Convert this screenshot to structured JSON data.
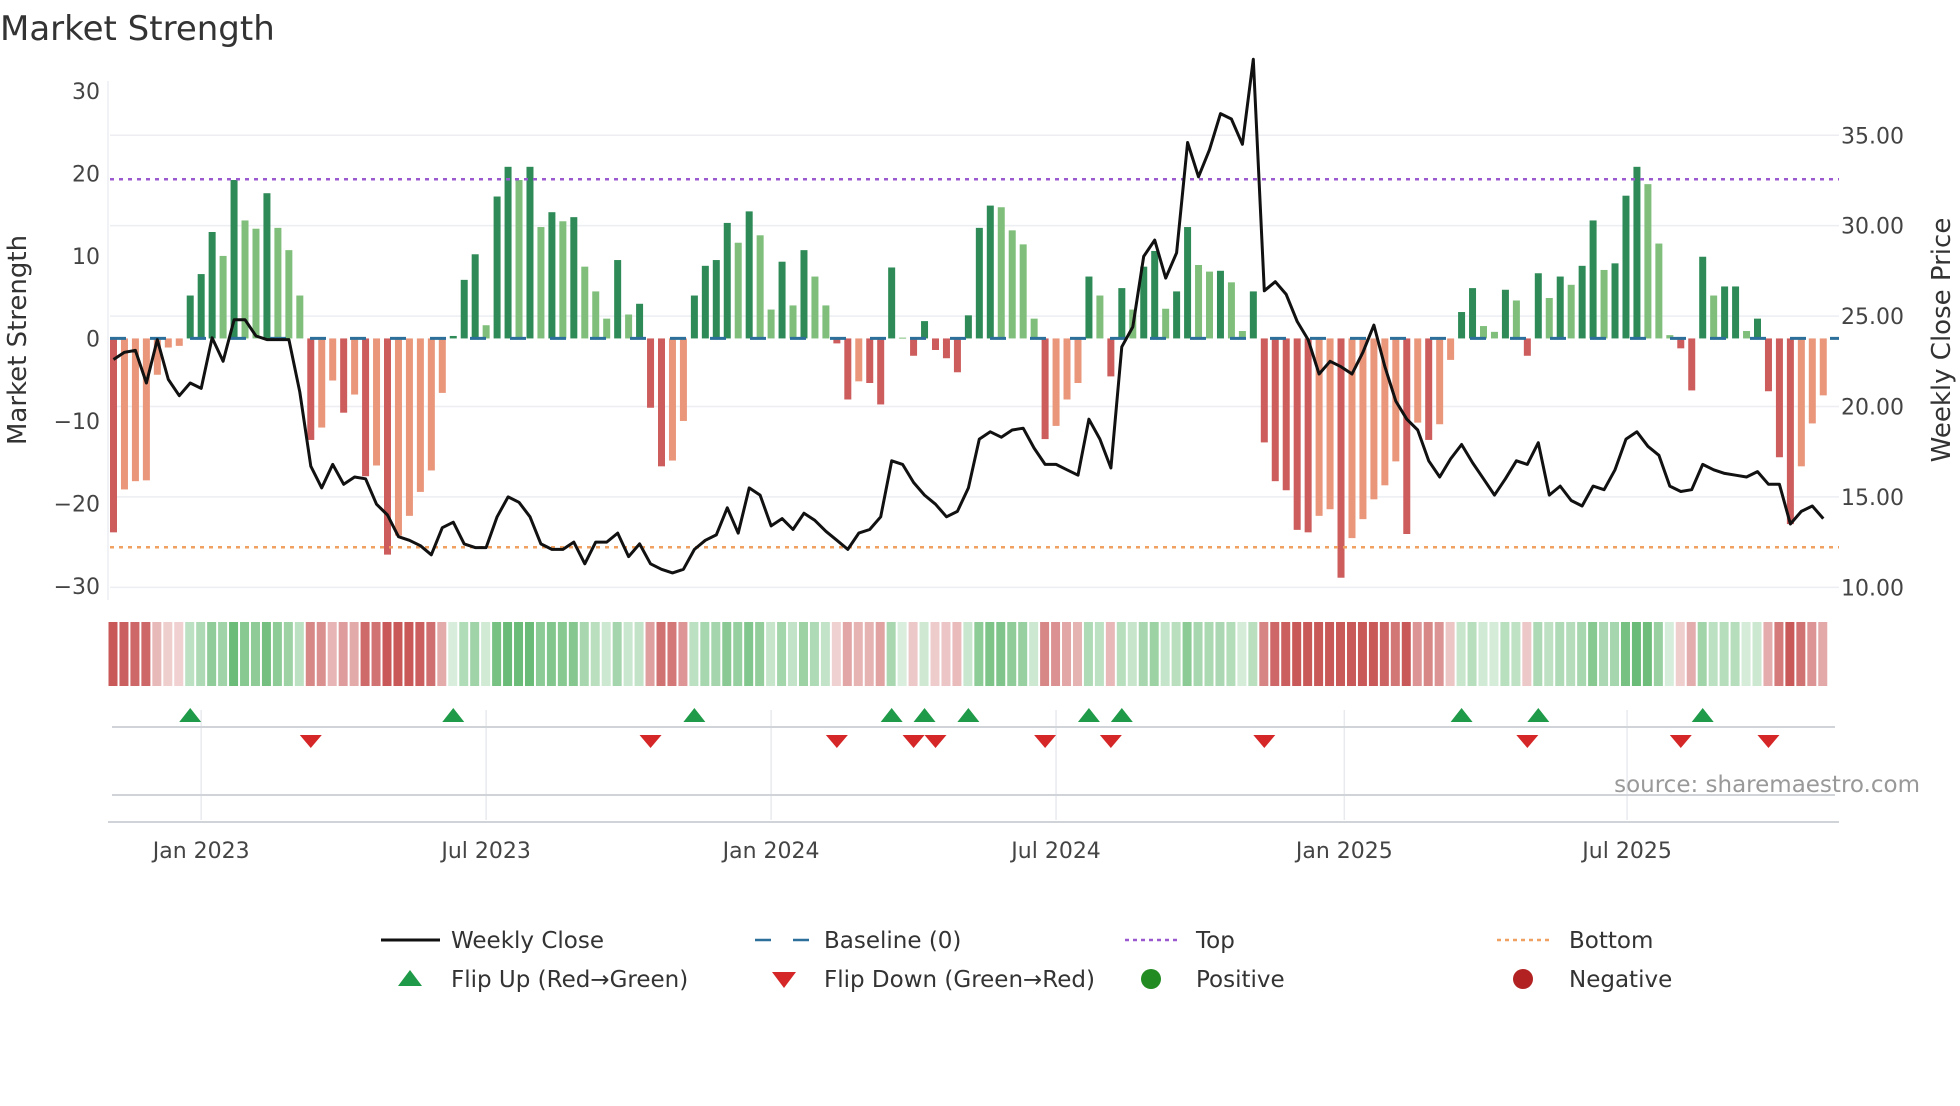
{
  "chart_data": {
    "type": "bar",
    "title": "Market Strength",
    "ylabel": "Market Strength",
    "y2label": "Weekly Close Price",
    "ylim": [
      -31.7,
      31.2
    ],
    "y2lim": [
      9.3,
      38.0
    ],
    "yticks": [
      30,
      20,
      10,
      0,
      -10,
      -20,
      -30
    ],
    "ytick_labels": [
      "30",
      "20",
      "10",
      "0",
      "−10",
      "−20",
      "−30"
    ],
    "y2ticks": [
      35,
      30,
      25,
      20,
      15,
      10
    ],
    "y2tick_labels": [
      "35.00",
      "30.00",
      "25.00",
      "20.00",
      "15.00",
      "10.00"
    ],
    "x_start": "2022-11-06",
    "x_step_days": 7,
    "xticks": [
      {
        "week": 8,
        "label": "Jan 2023"
      },
      {
        "week": 34,
        "label": "Jul 2023"
      },
      {
        "week": 60,
        "label": "Jan 2024"
      },
      {
        "week": 86,
        "label": "Jul 2024"
      },
      {
        "week": 112.3,
        "label": "Jan 2025"
      },
      {
        "week": 138.1,
        "label": "Jul 2025"
      }
    ],
    "top_level": 19.3,
    "bottom_level": -25.3,
    "baseline": 0,
    "strength": [
      -23.5,
      -18.3,
      -17.3,
      -17.2,
      -4.4,
      -1.1,
      -0.9,
      5.2,
      7.8,
      12.9,
      10.0,
      19.2,
      14.3,
      13.3,
      17.6,
      13.4,
      10.7,
      5.2,
      -12.3,
      -10.8,
      -5.1,
      -9.0,
      -6.8,
      -16.7,
      -15.4,
      -26.2,
      -23.9,
      -21.5,
      -18.6,
      -16.0,
      -6.6,
      0.3,
      7.1,
      10.2,
      1.6,
      17.2,
      20.8,
      19.2,
      20.8,
      13.5,
      15.3,
      14.2,
      14.7,
      8.7,
      5.7,
      2.4,
      9.5,
      2.9,
      4.2,
      -8.4,
      -15.5,
      -14.8,
      -10.0,
      5.2,
      8.8,
      9.5,
      14.0,
      11.6,
      15.4,
      12.5,
      3.5,
      9.3,
      4.0,
      10.7,
      7.5,
      4.0,
      -0.6,
      -7.4,
      -5.2,
      -5.4,
      -8.0,
      8.6,
      0.1,
      -2.1,
      2.1,
      -1.4,
      -2.4,
      -4.1,
      2.8,
      13.4,
      16.1,
      15.9,
      13.1,
      11.4,
      2.4,
      -12.2,
      -10.6,
      -7.4,
      -5.4,
      7.5,
      5.2,
      -4.6,
      6.1,
      3.5,
      8.7,
      10.6,
      3.6,
      5.7,
      13.5,
      8.9,
      8.1,
      8.2,
      6.8,
      0.9,
      5.7,
      -12.6,
      -17.3,
      -18.4,
      -23.2,
      -23.5,
      -21.5,
      -20.7,
      -29.0,
      -24.2,
      -21.9,
      -19.5,
      -17.8,
      -14.9,
      -23.7,
      -10.2,
      -12.3,
      -10.4,
      -2.6,
      3.2,
      6.1,
      1.5,
      0.8,
      5.9,
      4.6,
      -2.1,
      7.9,
      4.9,
      7.5,
      6.5,
      8.8,
      14.3,
      8.3,
      9.1,
      17.3,
      20.8,
      18.7,
      11.5,
      0.4,
      -1.2,
      -6.3,
      9.9,
      5.2,
      6.3,
      6.3,
      0.9,
      2.4,
      -6.4,
      -14.4,
      -22.5,
      -15.5,
      -10.3,
      -6.9
    ],
    "weekly_close": [
      22.6,
      23.0,
      23.1,
      21.3,
      23.7,
      21.5,
      20.6,
      21.3,
      21.0,
      23.8,
      22.5,
      24.8,
      24.8,
      23.9,
      23.7,
      23.7,
      23.7,
      20.8,
      16.7,
      15.5,
      16.8,
      15.7,
      16.1,
      16.0,
      14.6,
      14.0,
      12.8,
      12.6,
      12.3,
      11.8,
      13.3,
      13.6,
      12.4,
      12.2,
      12.2,
      13.9,
      15.0,
      14.7,
      13.9,
      12.4,
      12.1,
      12.1,
      12.5,
      11.3,
      12.5,
      12.5,
      13.0,
      11.7,
      12.4,
      11.3,
      11.0,
      10.8,
      11.0,
      12.1,
      12.6,
      12.9,
      14.4,
      13.0,
      15.5,
      15.1,
      13.4,
      13.8,
      13.2,
      14.1,
      13.7,
      13.1,
      12.6,
      12.1,
      13.0,
      13.2,
      13.9,
      17.0,
      16.8,
      15.8,
      15.1,
      14.6,
      13.9,
      14.2,
      15.5,
      18.2,
      18.6,
      18.3,
      18.7,
      18.8,
      17.7,
      16.8,
      16.8,
      16.5,
      16.2,
      19.3,
      18.2,
      16.6,
      23.3,
      24.4,
      28.3,
      29.2,
      27.1,
      28.5,
      34.6,
      32.7,
      34.2,
      36.2,
      35.9,
      34.5,
      39.2,
      26.4,
      26.9,
      26.2,
      24.7,
      23.7,
      21.8,
      22.5,
      22.2,
      21.8,
      23.0,
      24.5,
      22.2,
      20.3,
      19.3,
      18.7,
      17.0,
      16.1,
      17.1,
      17.9,
      16.9,
      16.0,
      15.1,
      16.0,
      17.0,
      16.8,
      18.0,
      15.1,
      15.6,
      14.8,
      14.5,
      15.6,
      15.4,
      16.5,
      18.2,
      18.6,
      17.8,
      17.3,
      15.6,
      15.3,
      15.4,
      16.8,
      16.5,
      16.3,
      16.2,
      16.1,
      16.4,
      15.7,
      15.7,
      13.5,
      14.2,
      14.5,
      13.8
    ],
    "flip_up_weeks": [
      7,
      31,
      53,
      71,
      74,
      78,
      89,
      92,
      123,
      130,
      145
    ],
    "flip_down_weeks": [
      18,
      49,
      66,
      73,
      75,
      85,
      91,
      105,
      129,
      143,
      151
    ],
    "legend": {
      "placement": "bottom",
      "items": [
        {
          "label": "Weekly Close",
          "kind": "line"
        },
        {
          "label": "Baseline (0)",
          "kind": "baseline"
        },
        {
          "label": "Top",
          "kind": "top"
        },
        {
          "label": "Bottom",
          "kind": "bottom"
        },
        {
          "label": "Flip Up (Red→Green)",
          "kind": "up"
        },
        {
          "label": "Flip Down (Green→Red)",
          "kind": "down"
        },
        {
          "label": "Positive",
          "kind": "pos"
        },
        {
          "label": "Negative",
          "kind": "neg"
        }
      ]
    },
    "source": "source: sharemaestro.com"
  },
  "colors": {
    "pos_strong": "#2e8b57",
    "pos_weak": "#7fbf7b",
    "neg_strong": "#cd5c5c",
    "neg_weak": "#e9967a",
    "baseline": "#2b6f9a",
    "top": "#9b59d0",
    "bottom": "#f0a060",
    "line": "#111111",
    "flip_up": "#1f9a48",
    "flip_down": "#d62728",
    "positive": "#228b22",
    "negative": "#b22222"
  }
}
